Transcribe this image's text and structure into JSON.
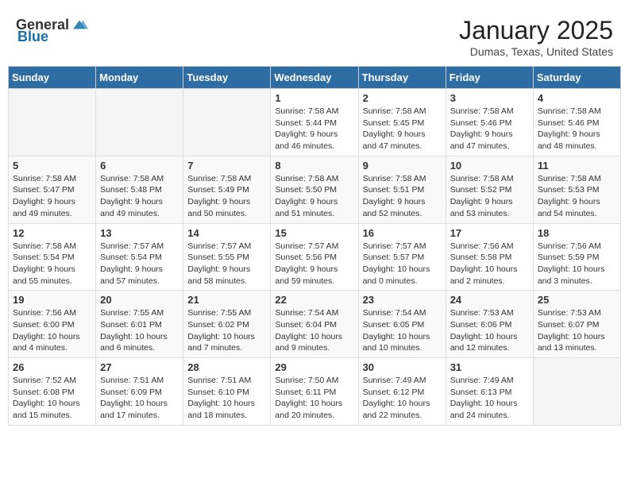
{
  "header": {
    "logo_general": "General",
    "logo_blue": "Blue",
    "month_title": "January 2025",
    "location": "Dumas, Texas, United States"
  },
  "weekdays": [
    "Sunday",
    "Monday",
    "Tuesday",
    "Wednesday",
    "Thursday",
    "Friday",
    "Saturday"
  ],
  "weeks": [
    [
      {
        "day": "",
        "sunrise": "",
        "sunset": "",
        "daylight": "",
        "empty": true
      },
      {
        "day": "",
        "sunrise": "",
        "sunset": "",
        "daylight": "",
        "empty": true
      },
      {
        "day": "",
        "sunrise": "",
        "sunset": "",
        "daylight": "",
        "empty": true
      },
      {
        "day": "1",
        "sunrise": "Sunrise: 7:58 AM",
        "sunset": "Sunset: 5:44 PM",
        "daylight": "Daylight: 9 hours and 46 minutes.",
        "empty": false
      },
      {
        "day": "2",
        "sunrise": "Sunrise: 7:58 AM",
        "sunset": "Sunset: 5:45 PM",
        "daylight": "Daylight: 9 hours and 47 minutes.",
        "empty": false
      },
      {
        "day": "3",
        "sunrise": "Sunrise: 7:58 AM",
        "sunset": "Sunset: 5:46 PM",
        "daylight": "Daylight: 9 hours and 47 minutes.",
        "empty": false
      },
      {
        "day": "4",
        "sunrise": "Sunrise: 7:58 AM",
        "sunset": "Sunset: 5:46 PM",
        "daylight": "Daylight: 9 hours and 48 minutes.",
        "empty": false
      }
    ],
    [
      {
        "day": "5",
        "sunrise": "Sunrise: 7:58 AM",
        "sunset": "Sunset: 5:47 PM",
        "daylight": "Daylight: 9 hours and 49 minutes.",
        "empty": false
      },
      {
        "day": "6",
        "sunrise": "Sunrise: 7:58 AM",
        "sunset": "Sunset: 5:48 PM",
        "daylight": "Daylight: 9 hours and 49 minutes.",
        "empty": false
      },
      {
        "day": "7",
        "sunrise": "Sunrise: 7:58 AM",
        "sunset": "Sunset: 5:49 PM",
        "daylight": "Daylight: 9 hours and 50 minutes.",
        "empty": false
      },
      {
        "day": "8",
        "sunrise": "Sunrise: 7:58 AM",
        "sunset": "Sunset: 5:50 PM",
        "daylight": "Daylight: 9 hours and 51 minutes.",
        "empty": false
      },
      {
        "day": "9",
        "sunrise": "Sunrise: 7:58 AM",
        "sunset": "Sunset: 5:51 PM",
        "daylight": "Daylight: 9 hours and 52 minutes.",
        "empty": false
      },
      {
        "day": "10",
        "sunrise": "Sunrise: 7:58 AM",
        "sunset": "Sunset: 5:52 PM",
        "daylight": "Daylight: 9 hours and 53 minutes.",
        "empty": false
      },
      {
        "day": "11",
        "sunrise": "Sunrise: 7:58 AM",
        "sunset": "Sunset: 5:53 PM",
        "daylight": "Daylight: 9 hours and 54 minutes.",
        "empty": false
      }
    ],
    [
      {
        "day": "12",
        "sunrise": "Sunrise: 7:58 AM",
        "sunset": "Sunset: 5:54 PM",
        "daylight": "Daylight: 9 hours and 55 minutes.",
        "empty": false
      },
      {
        "day": "13",
        "sunrise": "Sunrise: 7:57 AM",
        "sunset": "Sunset: 5:54 PM",
        "daylight": "Daylight: 9 hours and 57 minutes.",
        "empty": false
      },
      {
        "day": "14",
        "sunrise": "Sunrise: 7:57 AM",
        "sunset": "Sunset: 5:55 PM",
        "daylight": "Daylight: 9 hours and 58 minutes.",
        "empty": false
      },
      {
        "day": "15",
        "sunrise": "Sunrise: 7:57 AM",
        "sunset": "Sunset: 5:56 PM",
        "daylight": "Daylight: 9 hours and 59 minutes.",
        "empty": false
      },
      {
        "day": "16",
        "sunrise": "Sunrise: 7:57 AM",
        "sunset": "Sunset: 5:57 PM",
        "daylight": "Daylight: 10 hours and 0 minutes.",
        "empty": false
      },
      {
        "day": "17",
        "sunrise": "Sunrise: 7:56 AM",
        "sunset": "Sunset: 5:58 PM",
        "daylight": "Daylight: 10 hours and 2 minutes.",
        "empty": false
      },
      {
        "day": "18",
        "sunrise": "Sunrise: 7:56 AM",
        "sunset": "Sunset: 5:59 PM",
        "daylight": "Daylight: 10 hours and 3 minutes.",
        "empty": false
      }
    ],
    [
      {
        "day": "19",
        "sunrise": "Sunrise: 7:56 AM",
        "sunset": "Sunset: 6:00 PM",
        "daylight": "Daylight: 10 hours and 4 minutes.",
        "empty": false
      },
      {
        "day": "20",
        "sunrise": "Sunrise: 7:55 AM",
        "sunset": "Sunset: 6:01 PM",
        "daylight": "Daylight: 10 hours and 6 minutes.",
        "empty": false
      },
      {
        "day": "21",
        "sunrise": "Sunrise: 7:55 AM",
        "sunset": "Sunset: 6:02 PM",
        "daylight": "Daylight: 10 hours and 7 minutes.",
        "empty": false
      },
      {
        "day": "22",
        "sunrise": "Sunrise: 7:54 AM",
        "sunset": "Sunset: 6:04 PM",
        "daylight": "Daylight: 10 hours and 9 minutes.",
        "empty": false
      },
      {
        "day": "23",
        "sunrise": "Sunrise: 7:54 AM",
        "sunset": "Sunset: 6:05 PM",
        "daylight": "Daylight: 10 hours and 10 minutes.",
        "empty": false
      },
      {
        "day": "24",
        "sunrise": "Sunrise: 7:53 AM",
        "sunset": "Sunset: 6:06 PM",
        "daylight": "Daylight: 10 hours and 12 minutes.",
        "empty": false
      },
      {
        "day": "25",
        "sunrise": "Sunrise: 7:53 AM",
        "sunset": "Sunset: 6:07 PM",
        "daylight": "Daylight: 10 hours and 13 minutes.",
        "empty": false
      }
    ],
    [
      {
        "day": "26",
        "sunrise": "Sunrise: 7:52 AM",
        "sunset": "Sunset: 6:08 PM",
        "daylight": "Daylight: 10 hours and 15 minutes.",
        "empty": false
      },
      {
        "day": "27",
        "sunrise": "Sunrise: 7:51 AM",
        "sunset": "Sunset: 6:09 PM",
        "daylight": "Daylight: 10 hours and 17 minutes.",
        "empty": false
      },
      {
        "day": "28",
        "sunrise": "Sunrise: 7:51 AM",
        "sunset": "Sunset: 6:10 PM",
        "daylight": "Daylight: 10 hours and 18 minutes.",
        "empty": false
      },
      {
        "day": "29",
        "sunrise": "Sunrise: 7:50 AM",
        "sunset": "Sunset: 6:11 PM",
        "daylight": "Daylight: 10 hours and 20 minutes.",
        "empty": false
      },
      {
        "day": "30",
        "sunrise": "Sunrise: 7:49 AM",
        "sunset": "Sunset: 6:12 PM",
        "daylight": "Daylight: 10 hours and 22 minutes.",
        "empty": false
      },
      {
        "day": "31",
        "sunrise": "Sunrise: 7:49 AM",
        "sunset": "Sunset: 6:13 PM",
        "daylight": "Daylight: 10 hours and 24 minutes.",
        "empty": false
      },
      {
        "day": "",
        "sunrise": "",
        "sunset": "",
        "daylight": "",
        "empty": true
      }
    ]
  ]
}
